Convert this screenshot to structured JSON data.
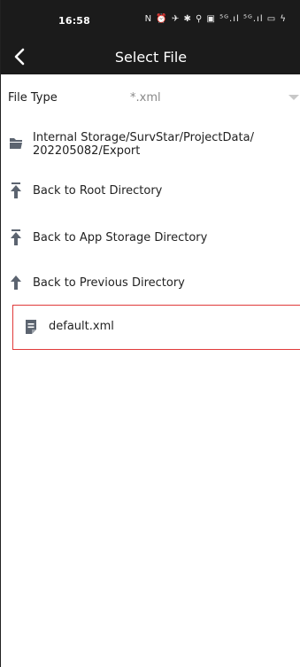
{
  "status_bar": {
    "time": "16:58",
    "icons_text": "N ⏰ ✈ ✱ ⚲ ▣ ⁵ᴳ.ıl ⁵ᴳ.ıl ▭ ϟ"
  },
  "app_bar": {
    "title": "Select File",
    "back_icon": "chevron-left-icon"
  },
  "file_type": {
    "label": "File Type",
    "value": "*.xml"
  },
  "list": {
    "current_path": "Internal Storage/SurvStar/ProjectData/\n202205082/Export",
    "back_to_root": "Back to Root Directory",
    "back_to_app_storage": "Back to App Storage Directory",
    "back_to_previous": "Back to Previous Directory",
    "files": [
      {
        "name": "default.xml"
      }
    ]
  },
  "colors": {
    "bar_bg": "#1b1b1b",
    "icon": "#5c6470",
    "selection_border": "#e03a3a"
  }
}
